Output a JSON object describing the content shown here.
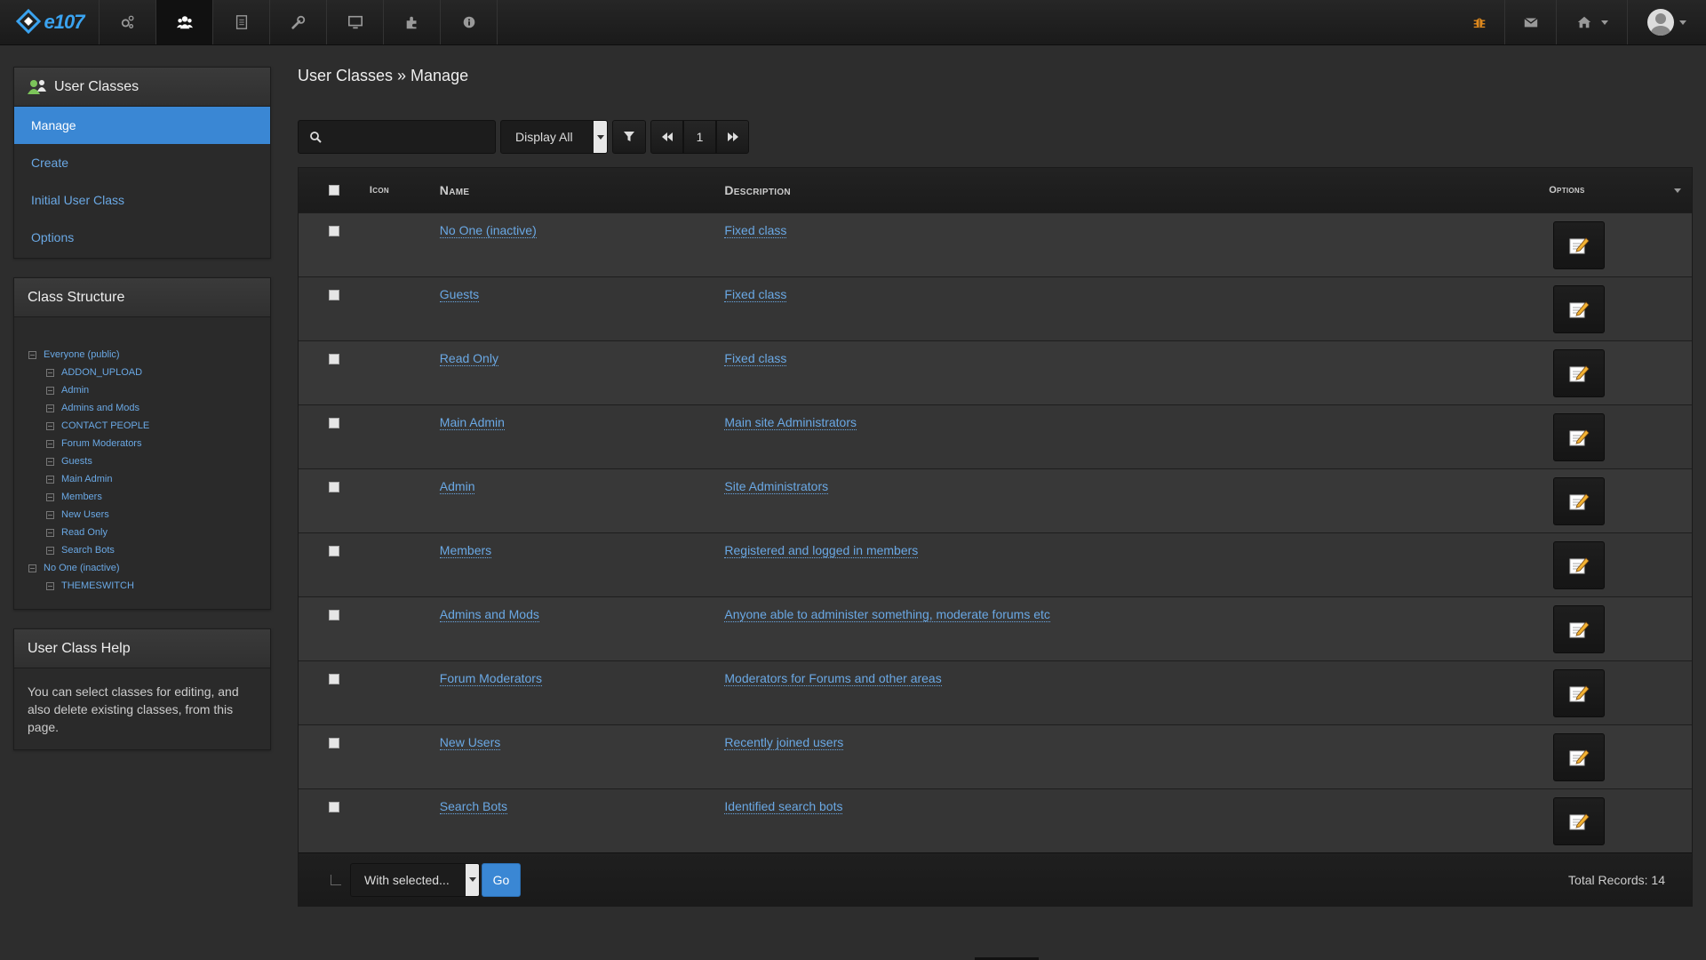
{
  "navbar": {
    "brand": "e107",
    "items": [
      {
        "name": "settings-icon",
        "active": false
      },
      {
        "name": "users-icon",
        "active": true
      },
      {
        "name": "content-icon",
        "active": false
      },
      {
        "name": "tools-icon",
        "active": false
      },
      {
        "name": "appearance-icon",
        "active": false
      },
      {
        "name": "plugins-icon",
        "active": false
      },
      {
        "name": "info-icon",
        "active": false
      }
    ],
    "right_icons": [
      "bug-icon",
      "mail-icon",
      "home-icon",
      "avatar"
    ]
  },
  "sidebar": {
    "user_classes_title": "User Classes",
    "menu": [
      {
        "label": "Manage",
        "active": true
      },
      {
        "label": "Create",
        "active": false
      },
      {
        "label": "Initial User Class",
        "active": false
      },
      {
        "label": "Options",
        "active": false
      }
    ],
    "structure_title": "Class Structure",
    "tree": [
      {
        "label": "Everyone (public)",
        "level": 0
      },
      {
        "label": "ADDON_UPLOAD",
        "level": 1
      },
      {
        "label": "Admin",
        "level": 1
      },
      {
        "label": "Admins and Mods",
        "level": 1
      },
      {
        "label": "CONTACT PEOPLE",
        "level": 1
      },
      {
        "label": "Forum Moderators",
        "level": 1
      },
      {
        "label": "Guests",
        "level": 1
      },
      {
        "label": "Main Admin",
        "level": 1
      },
      {
        "label": "Members",
        "level": 1
      },
      {
        "label": "New Users",
        "level": 1
      },
      {
        "label": "Read Only",
        "level": 1
      },
      {
        "label": "Search Bots",
        "level": 1
      },
      {
        "label": "No One (inactive)",
        "level": 0
      },
      {
        "label": "THEMESWITCH",
        "level": 1
      }
    ],
    "help_title": "User Class Help",
    "help_text": "You can select classes for editing, and also delete existing classes, from this page."
  },
  "main": {
    "breadcrumb": "User Classes » Manage",
    "search": {
      "placeholder": "",
      "value": ""
    },
    "display_select": "Display All",
    "page": "1",
    "columns": {
      "icon": "Icon",
      "name": "Name",
      "description": "Description",
      "options": "Options"
    },
    "rows": [
      {
        "name": "No One (inactive)",
        "description": "Fixed class"
      },
      {
        "name": "Guests",
        "description": "Fixed class"
      },
      {
        "name": "Read Only",
        "description": "Fixed class"
      },
      {
        "name": "Main Admin",
        "description": "Main site Administrators"
      },
      {
        "name": "Admin",
        "description": "Site Administrators"
      },
      {
        "name": "Members",
        "description": "Registered and logged in members"
      },
      {
        "name": "Admins and Mods",
        "description": "Anyone able to administer something, moderate forums etc"
      },
      {
        "name": "Forum Moderators",
        "description": "Moderators for Forums and other areas"
      },
      {
        "name": "New Users",
        "description": "Recently joined users"
      },
      {
        "name": "Search Bots",
        "description": "Identified search bots"
      }
    ],
    "with_selected": "With selected...",
    "go_label": "Go",
    "total_records": "Total Records: 14"
  },
  "colors": {
    "accent": "#3a87d4",
    "link": "#6aa8e4",
    "background": "#2d2d2d"
  }
}
